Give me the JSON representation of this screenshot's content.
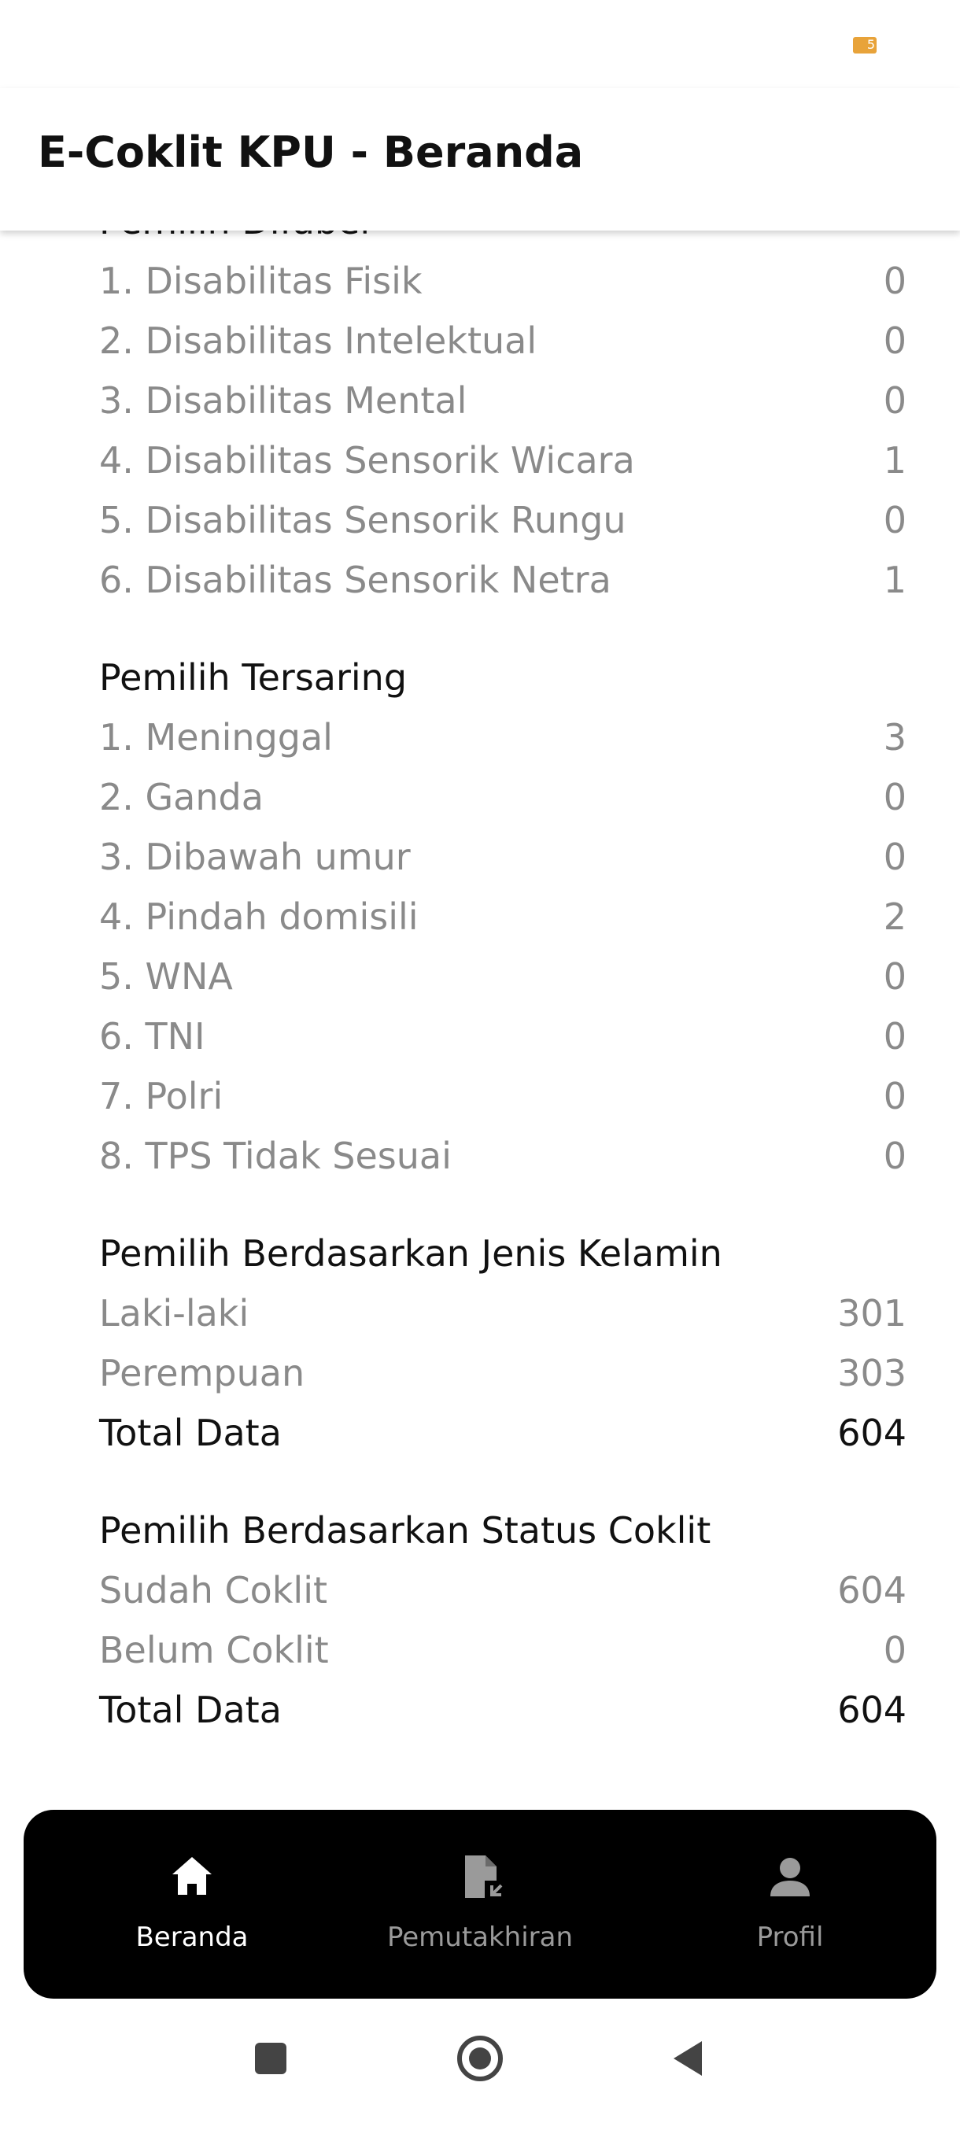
{
  "status_bar": {
    "battery_level": "5",
    "battery_color": "#e8a33a"
  },
  "app_bar": {
    "title": "E-Coklit KPU - Beranda"
  },
  "sections": {
    "disabled": {
      "title": "Pemilih Difabel",
      "rows": [
        {
          "label": "1. Disabilitas Fisik",
          "value": "0"
        },
        {
          "label": "2. Disabilitas Intelektual",
          "value": "0"
        },
        {
          "label": "3. Disabilitas Mental",
          "value": "0"
        },
        {
          "label": "4. Disabilitas Sensorik Wicara",
          "value": "1"
        },
        {
          "label": "5. Disabilitas Sensorik Rungu",
          "value": "0"
        },
        {
          "label": "6. Disabilitas Sensorik Netra",
          "value": "1"
        }
      ]
    },
    "filtered": {
      "title": "Pemilih Tersaring",
      "rows": [
        {
          "label": "1. Meninggal",
          "value": "3"
        },
        {
          "label": "2. Ganda",
          "value": "0"
        },
        {
          "label": "3. Dibawah umur",
          "value": "0"
        },
        {
          "label": "4. Pindah domisili",
          "value": "2"
        },
        {
          "label": "5. WNA",
          "value": "0"
        },
        {
          "label": "6. TNI",
          "value": "0"
        },
        {
          "label": "7. Polri",
          "value": "0"
        },
        {
          "label": "8. TPS Tidak Sesuai",
          "value": "0"
        }
      ]
    },
    "gender": {
      "title": "Pemilih Berdasarkan Jenis Kelamin",
      "rows": [
        {
          "label": "Laki-laki",
          "value": "301"
        },
        {
          "label": "Perempuan",
          "value": "303"
        }
      ],
      "total": {
        "label": "Total Data",
        "value": "604"
      }
    },
    "coklit_status": {
      "title": "Pemilih Berdasarkan Status Coklit",
      "rows": [
        {
          "label": "Sudah Coklit",
          "value": "604"
        },
        {
          "label": "Belum Coklit",
          "value": "0"
        }
      ],
      "total": {
        "label": "Total Data",
        "value": "604"
      }
    }
  },
  "bottom_nav": {
    "items": [
      {
        "label": "Beranda",
        "icon": "home-icon",
        "active": true
      },
      {
        "label": "Pemutakhiran",
        "icon": "file-update-icon",
        "active": false
      },
      {
        "label": "Profil",
        "icon": "person-icon",
        "active": false
      }
    ]
  },
  "colors": {
    "muted_text": "#8a8a8a",
    "primary_text": "#111111",
    "nav_background": "#000000",
    "nav_inactive": "#9a9a9a"
  }
}
